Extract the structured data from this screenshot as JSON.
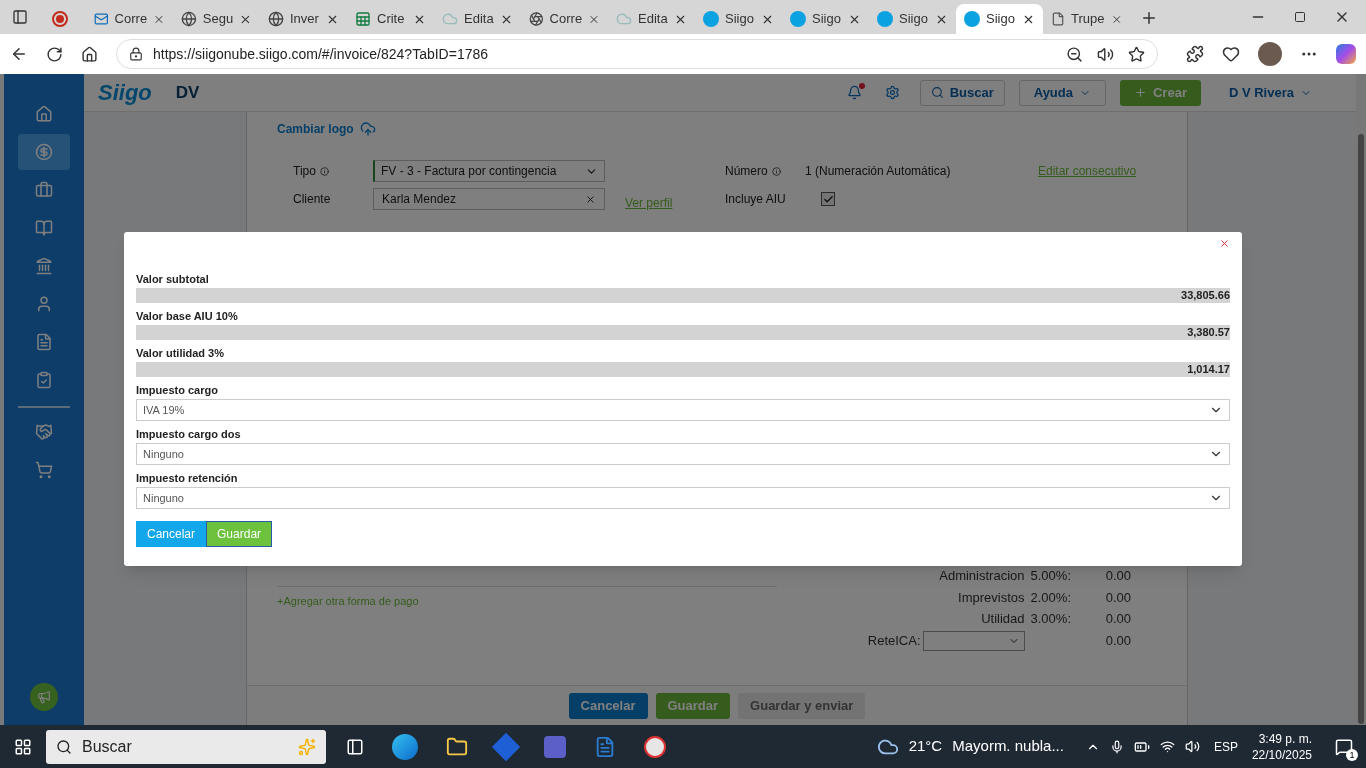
{
  "browser": {
    "tabs": [
      {
        "selected": false
      },
      {
        "title": "Corre",
        "selected": false
      },
      {
        "title": "Segu",
        "selected": false
      },
      {
        "title": "Inver",
        "selected": false
      },
      {
        "title": "Crite",
        "selected": false
      },
      {
        "title": "Edita",
        "selected": false
      },
      {
        "title": "Corre",
        "selected": false
      },
      {
        "title": "Edita",
        "selected": false
      },
      {
        "title": "Siigo",
        "selected": false
      },
      {
        "title": "Siigo",
        "selected": false
      },
      {
        "title": "Siigo",
        "selected": false
      },
      {
        "title": "Siigo",
        "selected": true
      },
      {
        "title": "Trupe",
        "selected": false
      }
    ],
    "url": "https://siigonube.siigo.com/#/invoice/824?TabID=1786"
  },
  "header": {
    "brand": "Siigo",
    "company": "DV",
    "search": "Buscar",
    "help": "Ayuda",
    "create": "Crear",
    "user": "D V Rivera",
    "notification": true
  },
  "sidebar": {
    "items": [
      {
        "selected": false
      },
      {
        "selected": true
      },
      {
        "selected": false
      },
      {
        "selected": false
      },
      {
        "selected": false
      },
      {
        "selected": false
      },
      {
        "selected": false
      },
      {
        "selected": false
      },
      {
        "selected": false
      },
      {
        "selected": false
      }
    ]
  },
  "form": {
    "logo_link": "Cambiar logo",
    "tipo": {
      "label": "Tipo",
      "value": "FV - 3 - Factura por contingencia"
    },
    "cliente": {
      "label": "Cliente",
      "value": "Karla Mendez",
      "link": "Ver perfil"
    },
    "numero": {
      "label": "Número",
      "value": "1 (Numeración Automática)",
      "link": "Editar consecutivo"
    },
    "aiu": {
      "label": "Incluye AIU",
      "checked": true
    }
  },
  "modal": {
    "fields": [
      {
        "kind": "readonly",
        "label": "Valor subtotal",
        "value": "33,805.66"
      },
      {
        "kind": "readonly",
        "label": "Valor base AIU 10%",
        "value": "3,380.57"
      },
      {
        "kind": "readonly",
        "label": "Valor utilidad 3%",
        "value": "1,014.17"
      },
      {
        "kind": "select",
        "label": "Impuesto cargo",
        "value": "IVA 19%"
      },
      {
        "kind": "select",
        "label": "Impuesto cargo dos",
        "value": "Ninguno"
      },
      {
        "kind": "select",
        "label": "Impuesto retención",
        "value": "Ninguno"
      }
    ],
    "cancel": "Cancelar",
    "save": "Guardar"
  },
  "payment_link": "+Agregar otra forma de pago",
  "totals": [
    {
      "kind": "text",
      "label": "Administracion",
      "rate": "5.00%:",
      "value": "0.00"
    },
    {
      "kind": "text",
      "label": "Imprevistos",
      "rate": "2.00%:",
      "value": "0.00"
    },
    {
      "kind": "text",
      "label": "Utilidad",
      "rate": "3.00%:",
      "value": "0.00"
    },
    {
      "kind": "select",
      "label": "ReteICA:",
      "value": "0.00"
    }
  ],
  "footer_buttons": [
    {
      "kind": "cancel",
      "label": "Cancelar",
      "disabled": false
    },
    {
      "kind": "save",
      "label": "Guardar",
      "disabled": false
    },
    {
      "kind": "save",
      "label": "Guardar y enviar",
      "disabled": true
    }
  ],
  "taskbar": {
    "search": "Buscar",
    "weather": "21°C",
    "forecast": "Mayorm. nubla...",
    "language": "ESP",
    "time": "3:49 p. m.",
    "date": "22/10/2025",
    "notifications": "1"
  }
}
